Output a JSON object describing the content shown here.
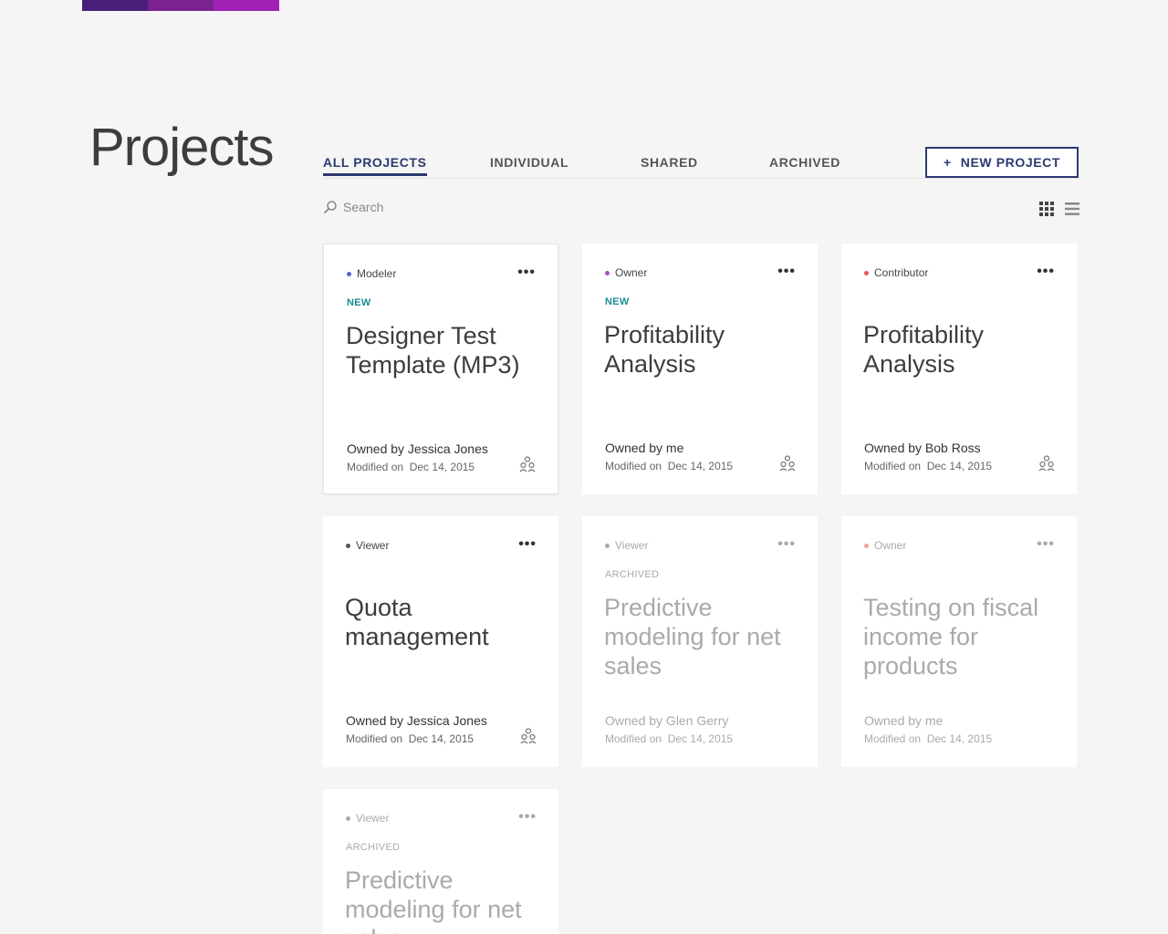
{
  "brand": {
    "colors": [
      "#4a1d7a",
      "#7a2291",
      "#a022b5"
    ]
  },
  "page_title": "Projects",
  "tabs": [
    {
      "label": "ALL PROJECTS",
      "active": true
    },
    {
      "label": "INDIVIDUAL",
      "active": false
    },
    {
      "label": "SHARED",
      "active": false
    },
    {
      "label": "ARCHIVED",
      "active": false
    }
  ],
  "new_project": {
    "plus": "+",
    "label": "NEW PROJECT"
  },
  "search": {
    "placeholder": "Search",
    "icon": "search-icon"
  },
  "view_toggle": {
    "grid_icon": "grid-view-icon",
    "list_icon": "list-view-icon"
  },
  "modified_label": "Modified on",
  "cards": [
    {
      "role": "Modeler",
      "role_color": "#5a5fd6",
      "badge": "NEW",
      "title": "Designer Test Template (MP3)",
      "owner": "Owned by Jessica Jones",
      "modified": "Dec 14, 2015",
      "shared": true
    },
    {
      "role": "Owner",
      "role_color": "#a94fc4",
      "badge": "NEW",
      "title": "Profitability Analysis",
      "owner": "Owned by me",
      "modified": "Dec 14, 2015",
      "shared": true
    },
    {
      "role": "Contributor",
      "role_color": "#e45b4f",
      "badge": "",
      "title": "Profitability Analysis",
      "owner": "Owned by Bob Ross",
      "modified": "Dec 14, 2015",
      "shared": true
    },
    {
      "role": "Viewer",
      "role_color": "#555555",
      "badge": "",
      "title": "Quota management",
      "owner": "Owned by Jessica Jones",
      "modified": "Dec 14, 2015",
      "shared": true
    },
    {
      "role": "Viewer",
      "role_color": "#aaaaaa",
      "badge": "ARCHIVED",
      "title": "Predictive modeling for net sales",
      "owner": "Owned by Glen Gerry",
      "modified": "Dec 14, 2015",
      "shared": false
    },
    {
      "role": "Owner",
      "role_color": "#f0a0a0",
      "badge": "",
      "title": "Testing on fiscal income for products",
      "owner": "Owned by me",
      "modified": "Dec 14, 2015",
      "shared": false
    },
    {
      "role": "Viewer",
      "role_color": "#aaaaaa",
      "badge": "ARCHIVED",
      "title": "Predictive modeling for net sales",
      "owner": "",
      "modified": "",
      "shared": false
    }
  ],
  "more_glyph": "•••"
}
